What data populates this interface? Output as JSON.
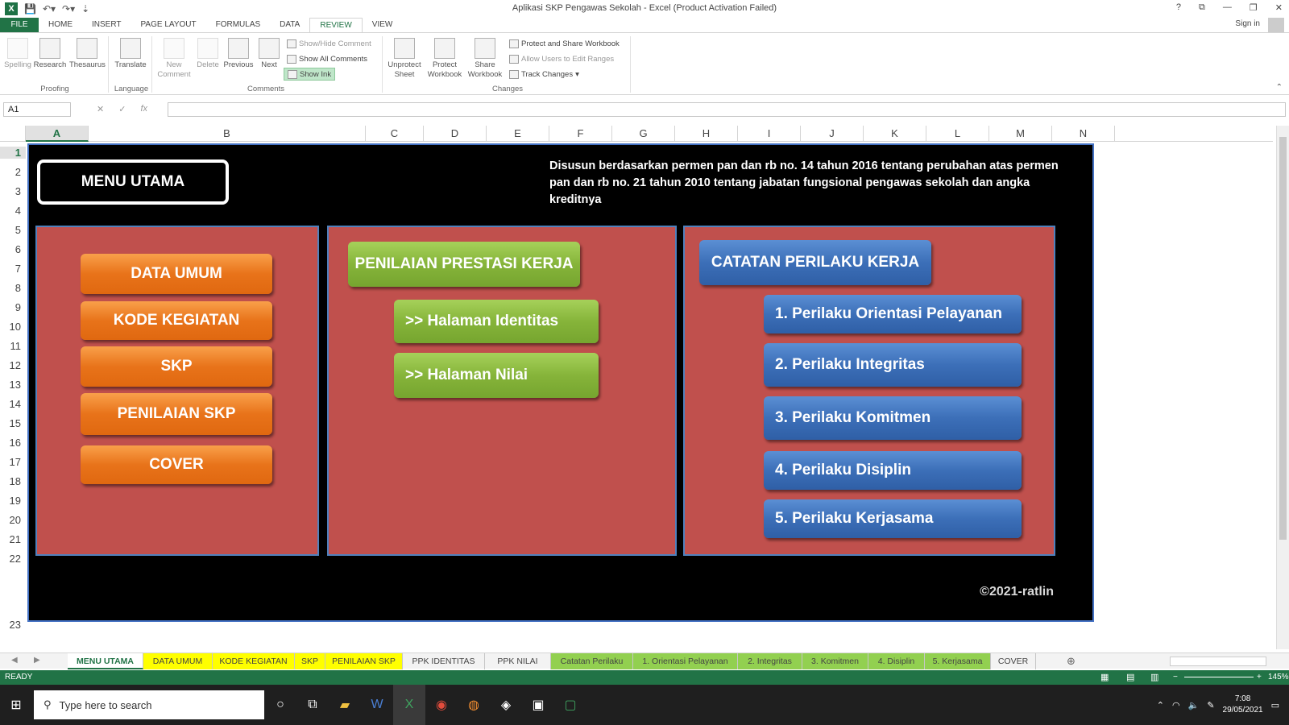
{
  "window": {
    "title": "Aplikasi SKP Pengawas Sekolah - Excel (Product Activation Failed)",
    "controls": [
      "?",
      "⧉",
      "—",
      "❐",
      "✕"
    ],
    "sign_in": "Sign in"
  },
  "ribbon_tabs": [
    "FILE",
    "HOME",
    "INSERT",
    "PAGE LAYOUT",
    "FORMULAS",
    "DATA",
    "REVIEW",
    "VIEW"
  ],
  "ribbon": {
    "proofing": {
      "label": "Proofing",
      "spelling": "Spelling",
      "research": "Research",
      "thesaurus": "Thesaurus"
    },
    "language": {
      "label": "Language",
      "translate": "Translate"
    },
    "comments": {
      "label": "Comments",
      "new_comment": "New Comment",
      "delete": "Delete",
      "previous": "Previous",
      "next": "Next",
      "show_hide": "Show/Hide Comment",
      "show_all": "Show All Comments",
      "show_ink": "Show Ink"
    },
    "changes": {
      "label": "Changes",
      "unprotect_sheet": "Unprotect Sheet",
      "protect_workbook": "Protect Workbook",
      "share_workbook": "Share Workbook",
      "protect_share": "Protect and Share Workbook",
      "allow_users": "Allow Users to Edit Ranges",
      "track_changes": "Track Changes"
    }
  },
  "formula_bar": {
    "name_box": "A1",
    "fx": "fx",
    "formula": ""
  },
  "columns": [
    "A",
    "B",
    "C",
    "D",
    "E",
    "F",
    "G",
    "H",
    "I",
    "J",
    "K",
    "L",
    "M",
    "N"
  ],
  "rows": [
    "1",
    "2",
    "3",
    "4",
    "5",
    "6",
    "7",
    "8",
    "9",
    "10",
    "11",
    "12",
    "13",
    "14",
    "15",
    "16",
    "17",
    "18",
    "19",
    "20",
    "21",
    "22",
    "23"
  ],
  "dashboard": {
    "menu_title": "MENU  UTAMA",
    "description": "Disusun berdasarkan permen pan dan rb no. 14 tahun 2016 tentang perubahan atas permen pan dan rb no. 21 tahun 2010 tentang jabatan fungsional pengawas sekolah dan angka kreditnya",
    "left_buttons": [
      "DATA UMUM",
      "KODE KEGIATAN",
      "SKP",
      "PENILAIAN SKP",
      "COVER"
    ],
    "ppk_title": "PENILAIAN PRESTASI KERJA",
    "ppk_buttons": [
      ">> Halaman Identitas",
      ">> Halaman Nilai"
    ],
    "perilaku_title": "CATATAN PERILAKU KERJA",
    "perilaku_buttons": [
      "1. Perilaku Orientasi Pelayanan",
      "2. Perilaku Integritas",
      "3. Perilaku Komitmen",
      "4. Perilaku Disiplin",
      "5. Perilaku Kerjasama"
    ],
    "copyright": "©2021-ratlin",
    "colors": {
      "background": "#000000",
      "panel": "#c0504d",
      "panel_border": "#4f81bd",
      "orange": "#e8731a",
      "green": "#86b43a",
      "blue": "#3c6fb8"
    }
  },
  "sheet_tabs": [
    "MENU UTAMA",
    "DATA UMUM",
    "KODE KEGIATAN",
    "SKP",
    "PENILAIAN SKP",
    "PPK IDENTITAS",
    "PPK NILAI",
    "Catatan Perilaku",
    "1. Orientasi Pelayanan",
    "2. Integritas",
    "3. Komitmen",
    "4. Disiplin",
    "5. Kerjasama",
    "COVER"
  ],
  "status": {
    "mode": "READY",
    "zoom": "145%"
  },
  "taskbar": {
    "search_placeholder": "Type here to search",
    "time": "7:08",
    "date": "29/05/2021"
  }
}
